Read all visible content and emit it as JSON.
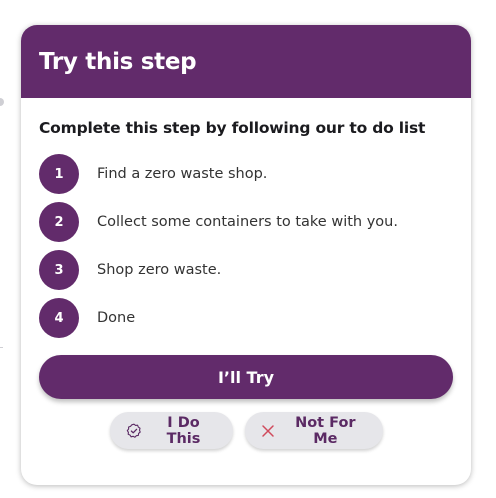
{
  "card": {
    "title": "Try this step",
    "subtitle": "Complete this step by following our to do list",
    "steps": [
      {
        "num": "1",
        "text": "Find a zero waste shop."
      },
      {
        "num": "2",
        "text": "Collect some containers to take with you."
      },
      {
        "num": "3",
        "text": "Shop zero waste."
      },
      {
        "num": "4",
        "text": "Done"
      }
    ],
    "primary_label": "I’ll Try",
    "do_this_label": "I Do This",
    "not_for_me_label": "Not For Me"
  },
  "icons": {
    "do_this": "badge-check-icon",
    "not_for_me": "close-icon"
  },
  "colors": {
    "brand_purple": "#622b6b",
    "pill_bg": "#e6e6ea",
    "close_icon": "#d04a5c"
  }
}
